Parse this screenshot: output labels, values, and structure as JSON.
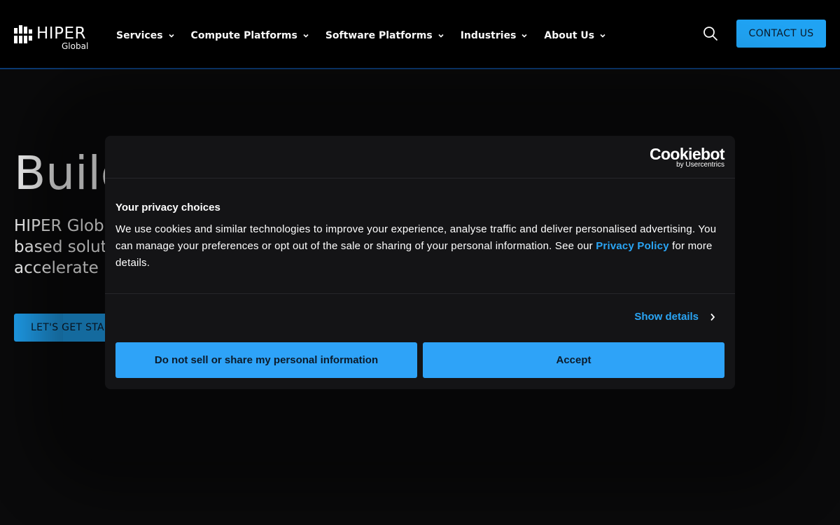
{
  "header": {
    "logo": {
      "name": "HIPER",
      "sub": "Global"
    },
    "nav": [
      {
        "label": "Services"
      },
      {
        "label": "Compute Platforms"
      },
      {
        "label": "Software Platforms"
      },
      {
        "label": "Industries"
      },
      {
        "label": "About Us"
      }
    ],
    "contact_label": "CONTACT US",
    "icons": {
      "search": "search-icon",
      "dropdown": "chevron-down-icon"
    }
  },
  "hero": {
    "title": "Build",
    "lines": [
      "HIPER Globa",
      "based solut",
      "accelerate p"
    ],
    "cta_label": "LET'S GET STAR"
  },
  "cookie_dialog": {
    "brand": "Cookiebot",
    "brand_sub": "by Usercentrics",
    "heading": "Your privacy choices",
    "text_before_link": "We use cookies and similar technologies to improve your experience, analyse traffic and deliver personalised advertising. You can manage your preferences or opt out of the sale or sharing of your personal information. See our ",
    "link_label": "Privacy Policy",
    "text_after_link": " for more details.",
    "show_details_label": "Show details",
    "deny_label": "Do not sell or share my personal information",
    "accept_label": "Accept"
  },
  "colors": {
    "background": "#0a0a0b",
    "header_bg": "#000000",
    "accent": "#20a3f3",
    "link": "#2aa5f5",
    "dialog_bg": "#141416"
  }
}
